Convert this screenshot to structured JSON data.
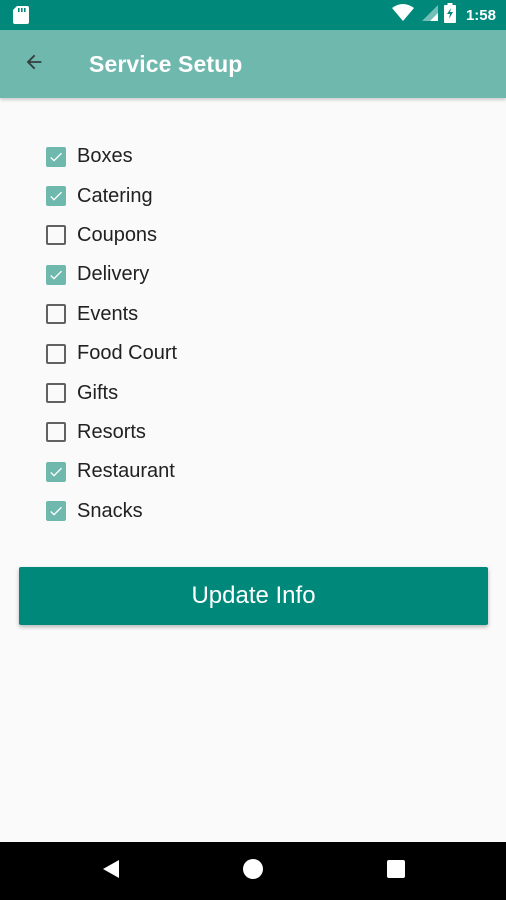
{
  "status_bar": {
    "time": "1:58",
    "icons": [
      "sd-card-icon",
      "wifi-icon",
      "signal-icon",
      "battery-icon"
    ]
  },
  "app_bar": {
    "title": "Service Setup",
    "back_icon": "arrow-back-icon"
  },
  "services": [
    {
      "label": "Boxes",
      "checked": true
    },
    {
      "label": "Catering",
      "checked": true
    },
    {
      "label": "Coupons",
      "checked": false
    },
    {
      "label": "Delivery",
      "checked": true
    },
    {
      "label": "Events",
      "checked": false
    },
    {
      "label": "Food Court",
      "checked": false
    },
    {
      "label": "Gifts",
      "checked": false
    },
    {
      "label": "Resorts",
      "checked": false
    },
    {
      "label": "Restaurant",
      "checked": true
    },
    {
      "label": "Snacks",
      "checked": true
    }
  ],
  "update_button": {
    "label": "Update Info"
  },
  "nav_bar": {
    "icons": [
      "back-triangle-icon",
      "home-circle-icon",
      "recents-square-icon"
    ]
  },
  "colors": {
    "status_bar": "#00897b",
    "app_bar": "#6fb8ad",
    "checkbox_checked": "#6fb8ad",
    "button": "#00897b",
    "background": "#fafafa"
  }
}
